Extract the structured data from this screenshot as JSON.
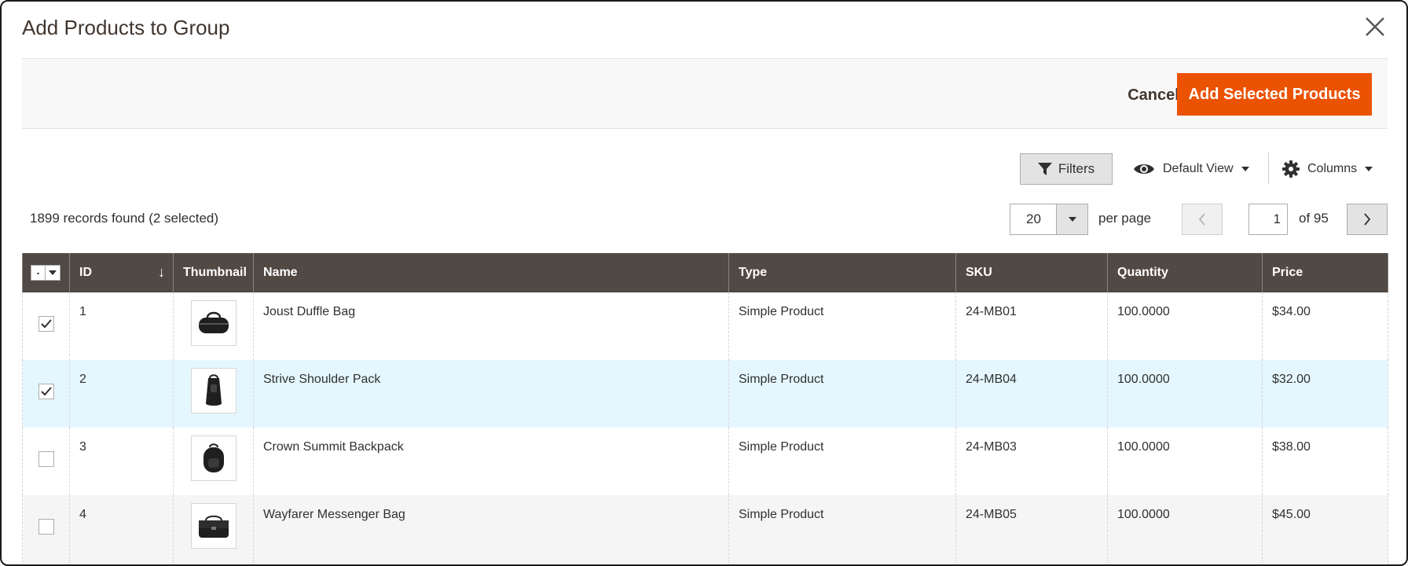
{
  "modal": {
    "title": "Add Products to Group"
  },
  "actions": {
    "cancel_label": "Cancel",
    "add_label": "Add Selected Products"
  },
  "toolbar": {
    "filters_label": "Filters",
    "view_label": "Default View",
    "columns_label": "Columns"
  },
  "summary": {
    "records_text": "1899 records found (2 selected)"
  },
  "pagination": {
    "per_page_value": "20",
    "per_page_label": "per page",
    "current_page": "1",
    "total_text": "of 95"
  },
  "table": {
    "columns": [
      "ID",
      "Thumbnail",
      "Name",
      "Type",
      "SKU",
      "Quantity",
      "Price"
    ],
    "mass_select_symbol": "-",
    "rows": [
      {
        "id": "1",
        "name": "Joust Duffle Bag",
        "type": "Simple Product",
        "sku": "24-MB01",
        "quantity": "100.0000",
        "price": "$34.00",
        "checked": true,
        "thumb_icon": "duffle-bag-icon"
      },
      {
        "id": "2",
        "name": "Strive Shoulder Pack",
        "type": "Simple Product",
        "sku": "24-MB04",
        "quantity": "100.0000",
        "price": "$32.00",
        "checked": true,
        "thumb_icon": "shoulder-pack-icon"
      },
      {
        "id": "3",
        "name": "Crown Summit Backpack",
        "type": "Simple Product",
        "sku": "24-MB03",
        "quantity": "100.0000",
        "price": "$38.00",
        "checked": false,
        "thumb_icon": "backpack-icon"
      },
      {
        "id": "4",
        "name": "Wayfarer Messenger Bag",
        "type": "Simple Product",
        "sku": "24-MB05",
        "quantity": "100.0000",
        "price": "$45.00",
        "checked": false,
        "thumb_icon": "messenger-bag-icon"
      }
    ]
  },
  "colors": {
    "primary": "#eb5202",
    "header_bg": "#514943",
    "selected_row": "#e5f7fe"
  }
}
